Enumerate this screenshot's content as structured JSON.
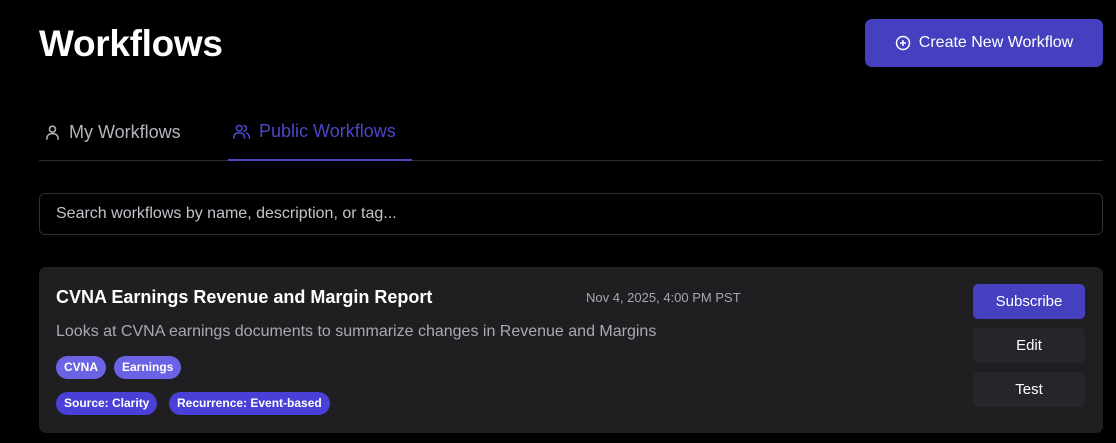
{
  "page": {
    "title": "Workflows"
  },
  "header": {
    "create_button_label": "Create New Workflow",
    "create_button_icon": "plus-circle-icon"
  },
  "tabs": [
    {
      "label": "My Workflows",
      "icon": "user-icon",
      "active": false
    },
    {
      "label": "Public Workflows",
      "icon": "users-icon",
      "active": true
    }
  ],
  "search": {
    "placeholder": "Search workflows by name, description, or tag...",
    "value": ""
  },
  "workflows": [
    {
      "title": "CVNA Earnings Revenue and Margin Report",
      "date": "Nov 4, 2025, 4:00 PM PST",
      "description": "Looks at CVNA earnings documents to summarize changes in Revenue and Margins",
      "tags": [
        "CVNA",
        "Earnings"
      ],
      "meta_tags": [
        "Source: Clarity",
        "Recurrence: Event-based"
      ],
      "actions": {
        "subscribe": "Subscribe",
        "edit": "Edit",
        "test": "Test"
      }
    }
  ],
  "colors": {
    "accent": "#4440bf",
    "active_tab": "#4a47c9",
    "tag_light": "#6a63e6",
    "tag_dark": "#4a3fd6",
    "card_bg": "#1f1f22",
    "page_bg": "#000000"
  }
}
